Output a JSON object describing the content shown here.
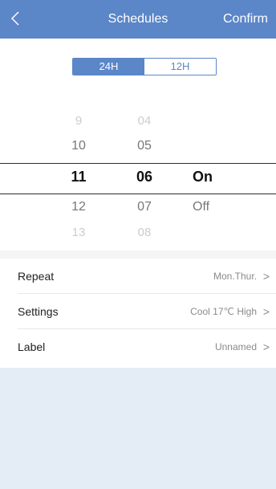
{
  "header": {
    "title": "Schedules",
    "confirm_label": "Confirm",
    "back_icon": "chevron-left-icon",
    "color": "#5b86c8"
  },
  "time_format": {
    "options": [
      "24H",
      "12H"
    ],
    "selected": "24H"
  },
  "picker": {
    "hours": [
      "9",
      "10",
      "11",
      "12",
      "13"
    ],
    "minutes": [
      "04",
      "05",
      "06",
      "07",
      "08"
    ],
    "modes": [
      "On",
      "Off"
    ],
    "selected": {
      "hour": "11",
      "minute": "06",
      "mode": "On"
    }
  },
  "settings": [
    {
      "label": "Repeat",
      "value": "Mon.Thur.",
      "chevron": ">"
    },
    {
      "label": "Settings",
      "value": "Cool 17℃ High",
      "chevron": ">"
    },
    {
      "label": "Label",
      "value": "Unnamed",
      "chevron": ">"
    }
  ]
}
